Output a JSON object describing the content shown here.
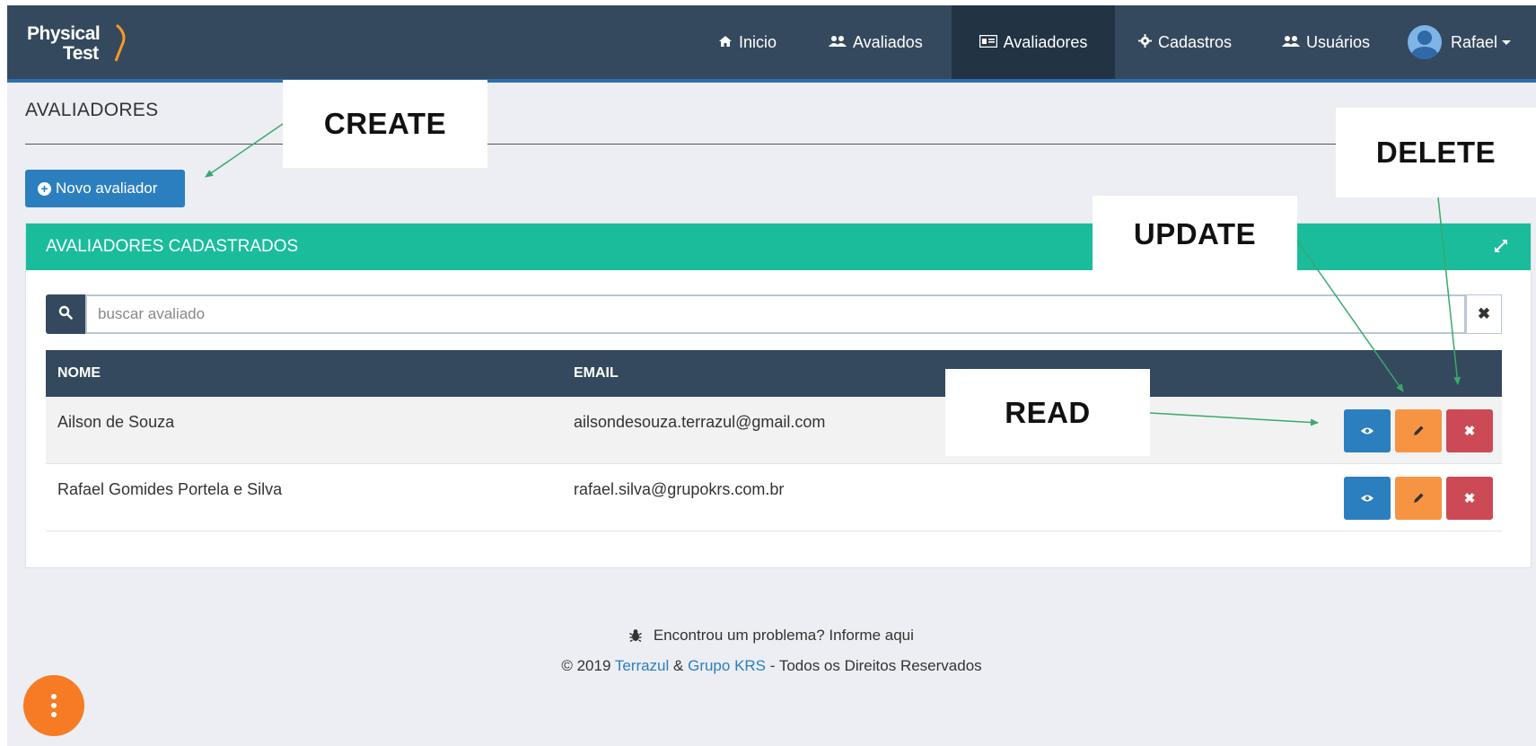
{
  "app": {
    "logo_line1": "Physical",
    "logo_line2": "Test"
  },
  "nav": {
    "items": [
      {
        "label": "Inicio",
        "icon": "home-icon"
      },
      {
        "label": "Avaliados",
        "icon": "users-icon"
      },
      {
        "label": "Avaliadores",
        "icon": "id-card-icon",
        "active": true
      },
      {
        "label": "Cadastros",
        "icon": "gear-icon"
      },
      {
        "label": "Usuários",
        "icon": "users-icon"
      }
    ],
    "user_name": "Rafael"
  },
  "page": {
    "title": "AVALIADORES",
    "new_button": "Novo avaliador"
  },
  "panel": {
    "title": "AVALIADORES CADASTRADOS",
    "search_placeholder": "buscar avaliado",
    "columns": [
      "NOME",
      "EMAIL"
    ],
    "rows": [
      {
        "nome": "Ailson de Souza",
        "email": "ailsondesouza.terrazul@gmail.com"
      },
      {
        "nome": "Rafael Gomides Portela e Silva",
        "email": "rafael.silva@grupokrs.com.br"
      }
    ]
  },
  "footer": {
    "report_text": "Encontrou um problema? Informe aqui",
    "copyright_prefix": "© 2019 ",
    "company1": "Terrazul",
    "amp": " & ",
    "company2": "Grupo KRS",
    "copyright_suffix": " - Todos os Direitos Reservados"
  },
  "annotations": {
    "create": "CREATE",
    "delete": "DELETE",
    "update": "UPDATE",
    "read": "READ",
    "arrow_color": "#3aa86b"
  },
  "colors": {
    "navbar": "#34495e",
    "panel_header": "#1abc9c",
    "primary": "#2c7fbf",
    "warning": "#f79444",
    "danger": "#cc4a55",
    "fab": "#f77b24"
  }
}
